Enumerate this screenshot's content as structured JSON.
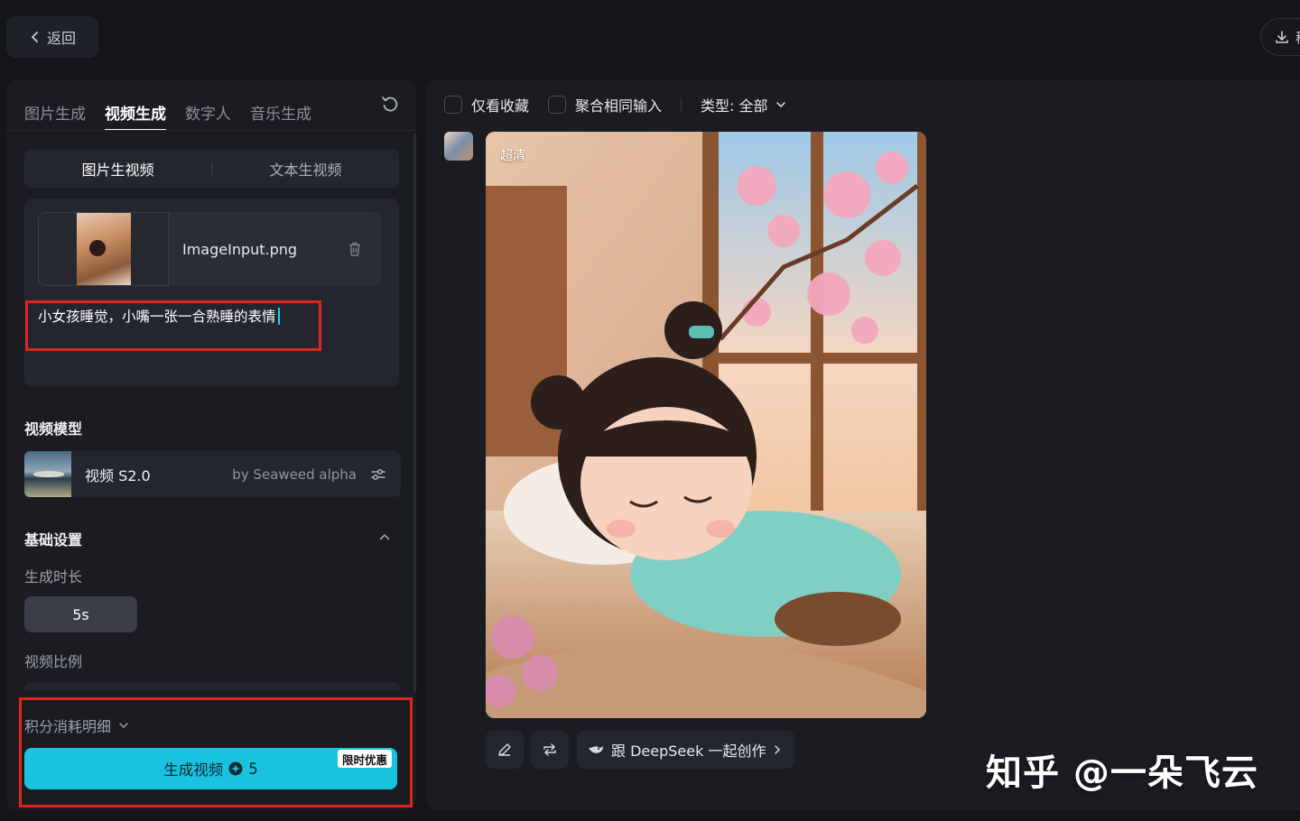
{
  "header": {
    "back_label": "返回",
    "download_label": "稻"
  },
  "left_panel": {
    "tabs": [
      {
        "label": "图片生成"
      },
      {
        "label": "视频生成"
      },
      {
        "label": "数字人"
      },
      {
        "label": "音乐生成"
      }
    ],
    "active_tab": "视频生成",
    "modes": [
      {
        "label": "图片生视频"
      },
      {
        "label": "文本生视频"
      }
    ],
    "upload": {
      "file_name": "ImageInput.png",
      "prompt": "小女孩睡觉，小嘴一张一合熟睡的表情"
    },
    "model_section": {
      "title": "视频模型",
      "model_name": "视频 S2.0",
      "model_by": "by Seaweed alpha"
    },
    "basic_settings": {
      "title": "基础设置",
      "duration_label": "生成时长",
      "duration_value": "5s",
      "ratio_label": "视频比例"
    },
    "footer": {
      "points_label": "积分消耗明细",
      "generate_label": "生成视频",
      "cost": "5",
      "promo_badge": "限时优惠"
    }
  },
  "right_panel": {
    "filters": {
      "favorites_only": "仅看收藏",
      "group_same_input": "聚合相同输入",
      "type_label": "类型: 全部"
    },
    "result": {
      "quality_badge": "超清"
    },
    "actions": {
      "deepseek_label": "跟 DeepSeek 一起创作"
    }
  },
  "watermark": "知乎 @一朵飞云",
  "colors": {
    "accent": "#19c3de",
    "highlight_border": "#e3241b",
    "panel_bg": "#1a1c22",
    "page_bg": "#13151a"
  }
}
